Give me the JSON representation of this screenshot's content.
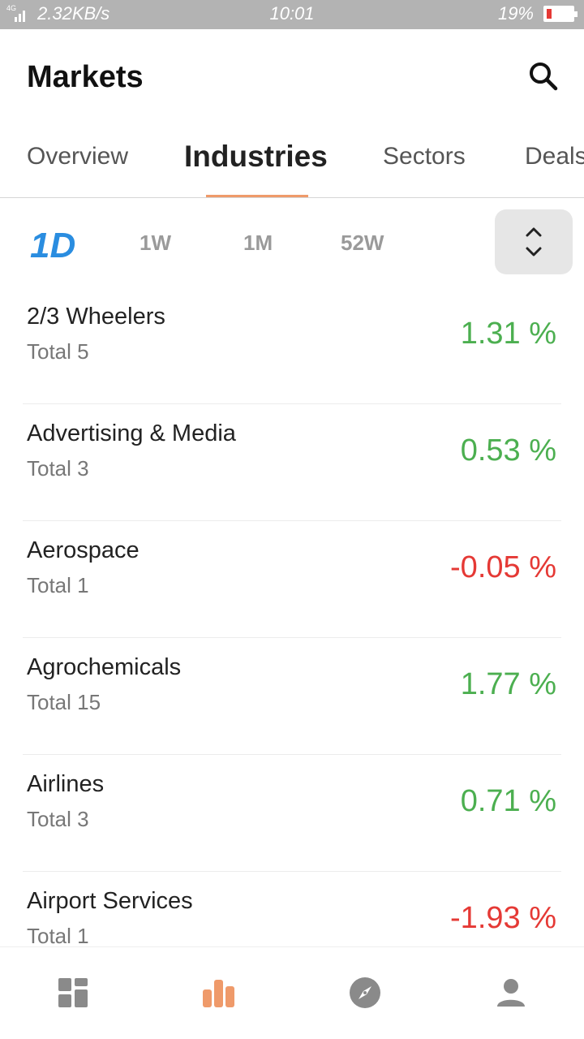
{
  "status_bar": {
    "network_label": "4G",
    "speed": "2.32KB/s",
    "time": "10:01",
    "battery": "19%",
    "battery_level": 0.19
  },
  "header": {
    "title": "Markets",
    "search_icon": "search-icon"
  },
  "tabs": [
    "Overview",
    "Industries",
    "Sectors",
    "Deals"
  ],
  "active_tab": "Industries",
  "filters": [
    "1D",
    "1W",
    "1M",
    "52W"
  ],
  "active_filter": "1D",
  "sort_icon": "sort-updown-icon",
  "industries": [
    {
      "name": "2/3 Wheelers",
      "total": "Total 5",
      "change": "1.31 %",
      "direction": "up"
    },
    {
      "name": "Advertising & Media",
      "total": "Total 3",
      "change": "0.53 %",
      "direction": "up"
    },
    {
      "name": "Aerospace",
      "total": "Total 1",
      "change": "-0.05 %",
      "direction": "down"
    },
    {
      "name": "Agrochemicals",
      "total": "Total 15",
      "change": "1.77 %",
      "direction": "up"
    },
    {
      "name": "Airlines",
      "total": "Total 3",
      "change": "0.71 %",
      "direction": "up"
    },
    {
      "name": "Airport Services",
      "total": "Total 1",
      "change": "-1.93 %",
      "direction": "down"
    }
  ],
  "bottom_nav": [
    {
      "icon": "dashboard-icon",
      "active": false
    },
    {
      "icon": "bar-chart-icon",
      "active": true
    },
    {
      "icon": "compass-icon",
      "active": false
    },
    {
      "icon": "profile-icon",
      "active": false
    }
  ],
  "colors": {
    "accent": "#ef9a6a",
    "filter_active": "#2a8de0",
    "positive": "#4caf50",
    "negative": "#e53935",
    "status_bar": "#b3b3b3"
  }
}
